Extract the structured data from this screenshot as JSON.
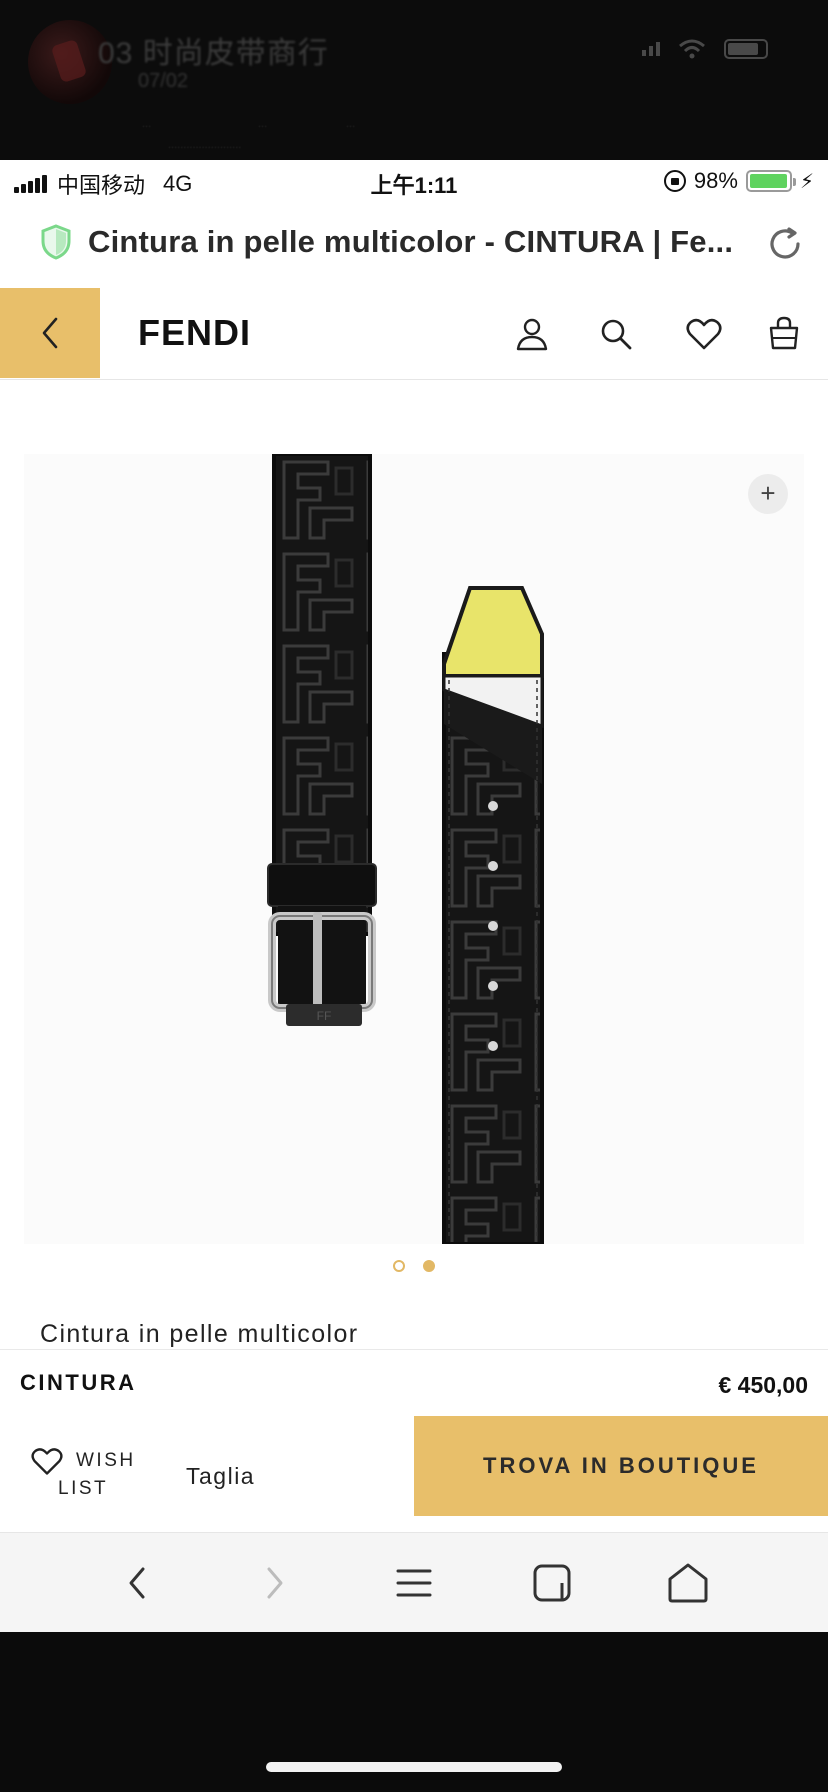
{
  "overlay": {
    "title": "03 时尚皮带商行",
    "date": "07/02",
    "tiny_links": [
      "...",
      "...",
      "..."
    ],
    "tiny_line": "........................"
  },
  "statusbar": {
    "carrier": "中国移动",
    "network": "4G",
    "time": "上午1:11",
    "battery": "98%",
    "battery_level": 0.98
  },
  "urlbar": {
    "page_title": "Cintura in pelle multicolor - CINTURA | Fe..."
  },
  "header": {
    "logo": "FENDI"
  },
  "gallery": {
    "zoom_label": "+",
    "dot_count": 2,
    "active_dot": 2
  },
  "product": {
    "name": "Cintura in pelle multicolor",
    "category": "CINTURA",
    "price": "€ 450,00"
  },
  "actions": {
    "wish_line1": "WISH",
    "wish_line2": "LIST",
    "size_label": "Taglia",
    "cta": "TROVA IN BOUTIQUE"
  },
  "colors": {
    "accent": "#e8bf6a",
    "battery": "#5fd35f",
    "shield": "#7bd88a"
  },
  "icons": [
    "shield-icon",
    "reload-icon",
    "chevron-left-icon",
    "user-icon",
    "search-icon",
    "heart-icon",
    "shopping-bag-icon",
    "plus-icon",
    "back-arrow-icon",
    "forward-arrow-icon",
    "menu-icon",
    "tabs-icon",
    "home-icon"
  ]
}
